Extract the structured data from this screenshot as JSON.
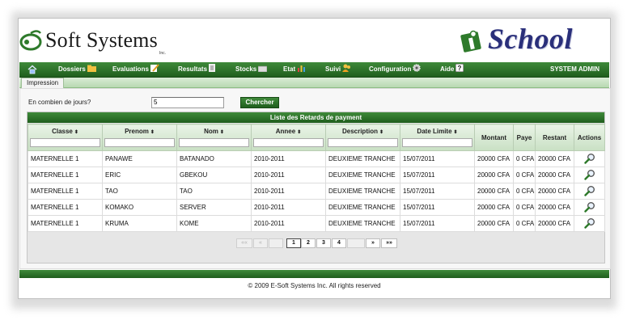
{
  "brand": {
    "left_logo_text": "Soft Systems",
    "left_logo_sub": "Inc.",
    "right_logo_text": "School"
  },
  "menu": {
    "items": [
      {
        "label": "Dossiers",
        "icon": "folder-icon"
      },
      {
        "label": "Evaluations",
        "icon": "pencil-icon"
      },
      {
        "label": "Resultats",
        "icon": "document-icon"
      },
      {
        "label": "Stocks",
        "icon": "box-icon"
      },
      {
        "label": "Etat",
        "icon": "bar-chart-icon"
      },
      {
        "label": "Suivi",
        "icon": "users-icon"
      },
      {
        "label": "Configuration",
        "icon": "gear-icon"
      },
      {
        "label": "Aide",
        "icon": "help-icon"
      }
    ],
    "user": "SYSTEM ADMIN"
  },
  "subnav": {
    "tab": "Impression"
  },
  "search": {
    "label": "En combien de jours?",
    "value": "5",
    "button": "Chercher"
  },
  "table": {
    "title": "Liste des Retards de payment",
    "headers": {
      "classe": "Classe",
      "prenom": "Prenom",
      "nom": "Nom",
      "annee": "Annee",
      "description": "Description",
      "date_limite": "Date Limite",
      "montant": "Montant",
      "paye": "Paye",
      "restant": "Restant",
      "actions": "Actions"
    },
    "sort_glyph": "⬍",
    "rows": [
      {
        "classe": "MATERNELLE 1",
        "prenom": "PANAWE",
        "nom": "BATANADO",
        "annee": "2010-2011",
        "description": "DEUXIEME TRANCHE",
        "date_limite": "15/07/2011",
        "montant": "20000 CFA",
        "paye": "0 CFA",
        "restant": "20000 CFA"
      },
      {
        "classe": "MATERNELLE 1",
        "prenom": "ERIC",
        "nom": "GBEKOU",
        "annee": "2010-2011",
        "description": "DEUXIEME TRANCHE",
        "date_limite": "15/07/2011",
        "montant": "20000 CFA",
        "paye": "0 CFA",
        "restant": "20000 CFA"
      },
      {
        "classe": "MATERNELLE 1",
        "prenom": "TAO",
        "nom": "TAO",
        "annee": "2010-2011",
        "description": "DEUXIEME TRANCHE",
        "date_limite": "15/07/2011",
        "montant": "20000 CFA",
        "paye": "0 CFA",
        "restant": "20000 CFA"
      },
      {
        "classe": "MATERNELLE 1",
        "prenom": "KOMAKO",
        "nom": "SERVER",
        "annee": "2010-2011",
        "description": "DEUXIEME TRANCHE",
        "date_limite": "15/07/2011",
        "montant": "20000 CFA",
        "paye": "0 CFA",
        "restant": "20000 CFA"
      },
      {
        "classe": "MATERNELLE 1",
        "prenom": "KRUMA",
        "nom": "KOME",
        "annee": "2010-2011",
        "description": "DEUXIEME TRANCHE",
        "date_limite": "15/07/2011",
        "montant": "20000 CFA",
        "paye": "0 CFA",
        "restant": "20000 CFA"
      }
    ]
  },
  "pager": {
    "first": "««",
    "prev": "«",
    "pages": [
      "1",
      "2",
      "3",
      "4"
    ],
    "current": "1",
    "next": "»",
    "last": "»»"
  },
  "footer": {
    "copyright": "© 2009 E-Soft Systems Inc. All rights reserved"
  },
  "colors": {
    "brand_green": "#2e7a2b",
    "logo_navy": "#2a2f7a",
    "header_tint": "#c9e0c4"
  }
}
